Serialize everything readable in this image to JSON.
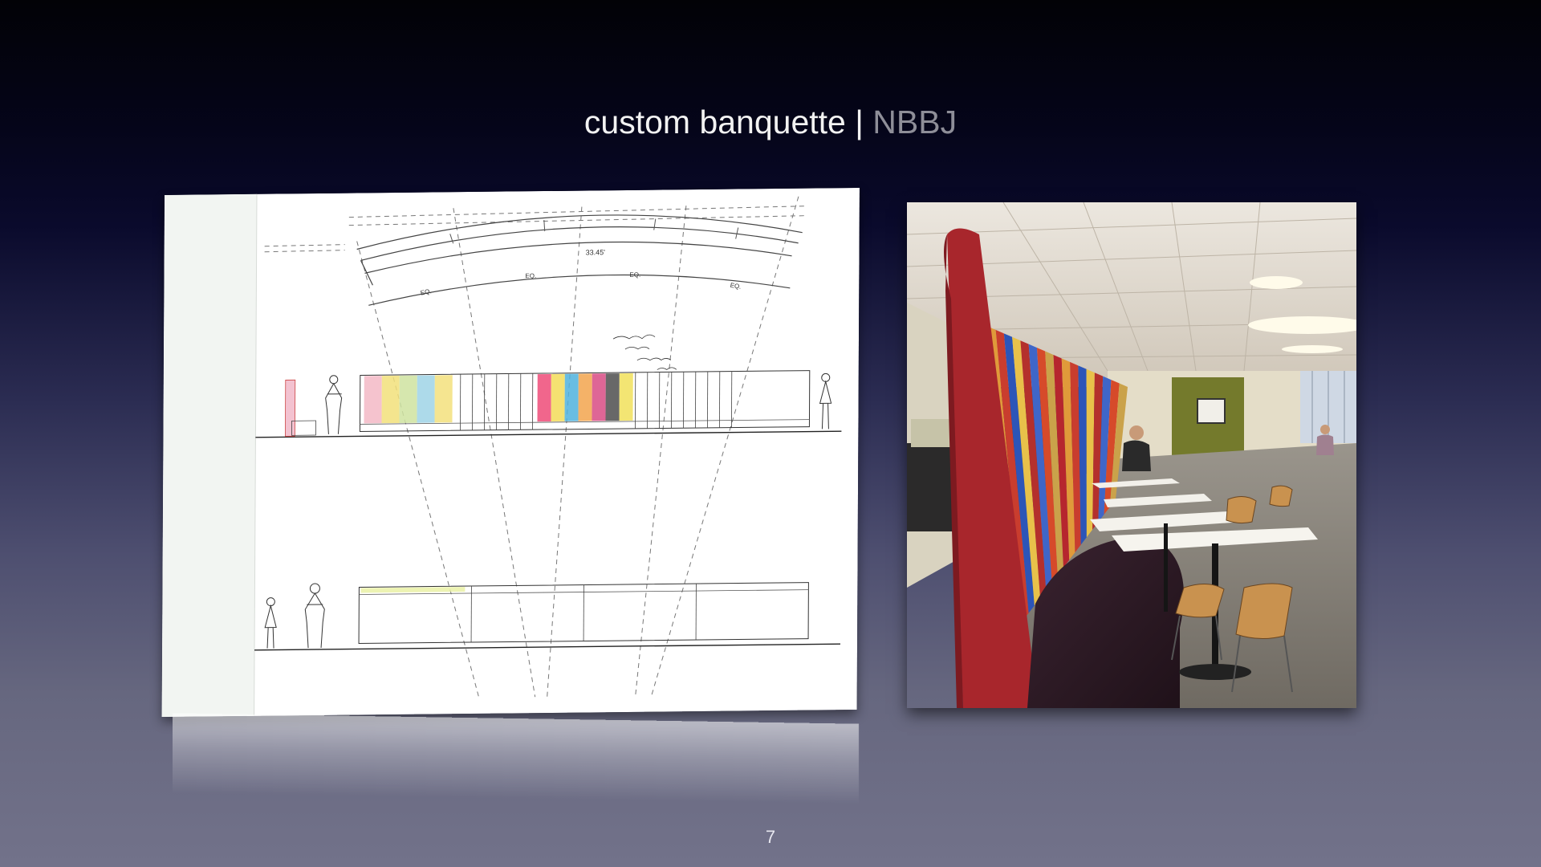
{
  "slide": {
    "title_main": "custom banquette | ",
    "title_accent": "NBBJ",
    "page_number": "7"
  },
  "drawing": {
    "dimension_label": "33.45'",
    "eq_labels": [
      "EQ.",
      "EQ.",
      "EQ.",
      "EQ."
    ],
    "stripe_colors": [
      "#f3b9c6",
      "#f2e07a",
      "#cfe3a0",
      "#9fd3e6",
      "#f3e07c"
    ],
    "stripe_colors_2": [
      "#ee4b78",
      "#f3dc58",
      "#4fb2dd",
      "#f2a44e",
      "#d84b84",
      "#4d4d4d",
      "#f1e05a"
    ]
  },
  "photo": {
    "stripe_colors": [
      "#b6262e",
      "#e09a3a",
      "#c93d2e",
      "#2c55b8",
      "#e8c14a",
      "#b4302c",
      "#3f66c8",
      "#d64a2a",
      "#caa24a"
    ]
  }
}
